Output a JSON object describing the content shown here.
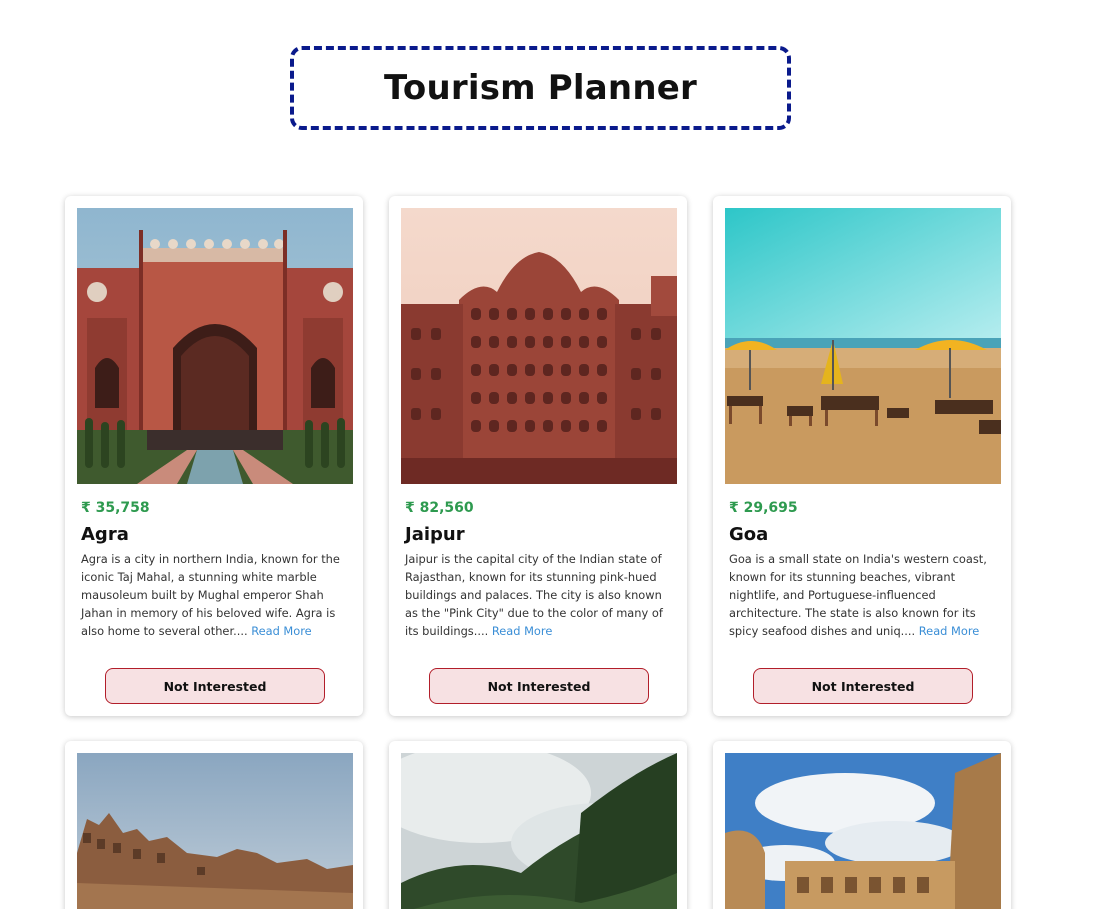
{
  "header": {
    "title": "Tourism Planner"
  },
  "cards": [
    {
      "price": "₹ 35,758",
      "city": "Agra",
      "description": "Agra is a city in northern India, known for the iconic Taj Mahal, a stunning white marble mausoleum built by Mughal emperor Shah Jahan in memory of his beloved wife. Agra is also home to several other....",
      "read_more": "Read More",
      "button": "Not Interested"
    },
    {
      "price": "₹ 82,560",
      "city": "Jaipur",
      "description": "Jaipur is the capital city of the Indian state of Rajasthan, known for its stunning pink-hued buildings and palaces. The city is also known as the \"Pink City\" due to the color of many of its buildings....",
      "read_more": "Read More",
      "button": "Not Interested"
    },
    {
      "price": "₹ 29,695",
      "city": "Goa",
      "description": "Goa is a small state on India's western coast, known for its stunning beaches, vibrant nightlife, and Portuguese-influenced architecture. The state is also known for its spicy seafood dishes and uniq....",
      "read_more": "Read More",
      "button": "Not Interested"
    }
  ],
  "colors": {
    "title_border": "#0a1a8c",
    "price": "#2e9a4f",
    "read_more": "#3a8ed6",
    "button_bg": "#f7e1e3",
    "button_border": "#b21e2a"
  }
}
